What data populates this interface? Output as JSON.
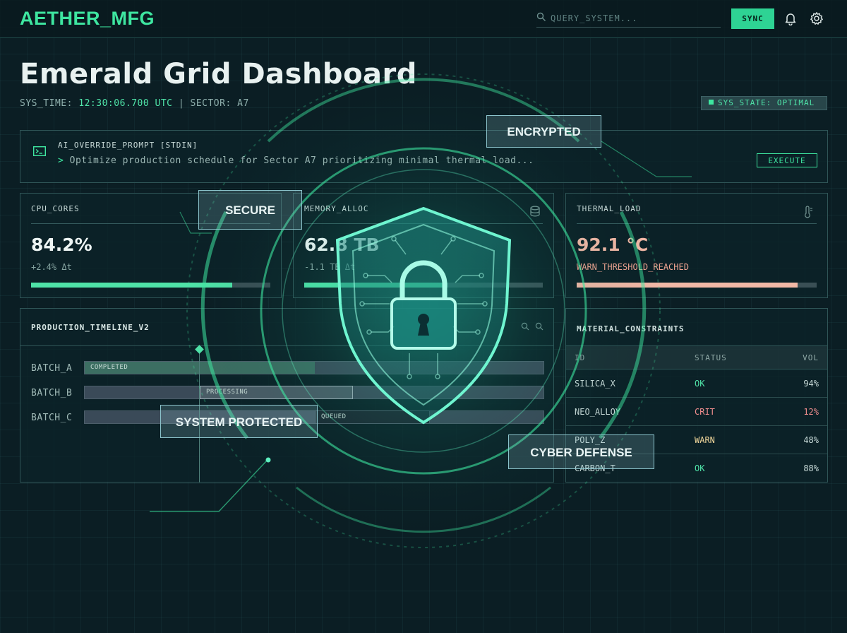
{
  "app": {
    "brand": "AETHER_MFG",
    "search_placeholder": "QUERY_SYSTEM...",
    "sync_label": "SYNC"
  },
  "header": {
    "title": "Emerald Grid Dashboard",
    "sys_time_label": "SYS_TIME:",
    "sys_time_value": "12:30:06.700 UTC",
    "separator": "|",
    "sector": "SECTOR: A7",
    "state": "SYS_STATE: OPTIMAL"
  },
  "prompt": {
    "label": "AI_OVERRIDE_PROMPT [STDIN]",
    "caret": ">",
    "text": "Optimize production schedule for Sector A7 prioritizing minimal thermal load...",
    "execute_label": "EXECUTE"
  },
  "metrics": [
    {
      "label": "CPU_CORES",
      "value": "84.2%",
      "sub": "+2.4% Δt",
      "progress": 0.84
    },
    {
      "label": "MEMORY_ALLOC",
      "value": "62.8 TB",
      "sub": "-1.1 TB Δt",
      "progress": 0.6
    },
    {
      "label": "THERMAL_LOAD",
      "value": "92.1 °C",
      "sub": "WARN_THRESHOLD_REACHED",
      "progress": 0.92
    }
  ],
  "timeline": {
    "title": "PRODUCTION_TIMELINE_V2",
    "rows": [
      {
        "label": "BATCH_A",
        "bar": "COMPLETED"
      },
      {
        "label": "BATCH_B",
        "bar": "PROCESSING"
      },
      {
        "label": "BATCH_C",
        "bar": "QUEUED"
      }
    ]
  },
  "materials": {
    "title": "MATERIAL_CONSTRAINTS",
    "columns": [
      "ID",
      "STATUS",
      "VOL"
    ],
    "rows": [
      {
        "id": "SILICA_X",
        "status": "OK",
        "vol": "94%"
      },
      {
        "id": "NEO_ALLOY",
        "status": "CRIT",
        "vol": "12%"
      },
      {
        "id": "POLY_Z",
        "status": "WARN",
        "vol": "48%"
      },
      {
        "id": "CARBON_T",
        "status": "OK",
        "vol": "88%"
      }
    ]
  },
  "overlay": {
    "encrypted": "ENCRYPTED",
    "secure": "SECURE",
    "system_protected": "SYSTEM PROTECTED",
    "cyber_defense": "CYBER DEFENSE"
  },
  "colors": {
    "accent": "#3ee6a0",
    "background": "#0b1e24",
    "warning": "#f2b8a6",
    "critical": "#f28f8f"
  },
  "icons": [
    "search-icon",
    "bell-icon",
    "gear-icon",
    "terminal-icon",
    "database-icon",
    "thermometer-icon",
    "zoom-in-icon",
    "zoom-out-icon",
    "shield-lock-icon"
  ]
}
